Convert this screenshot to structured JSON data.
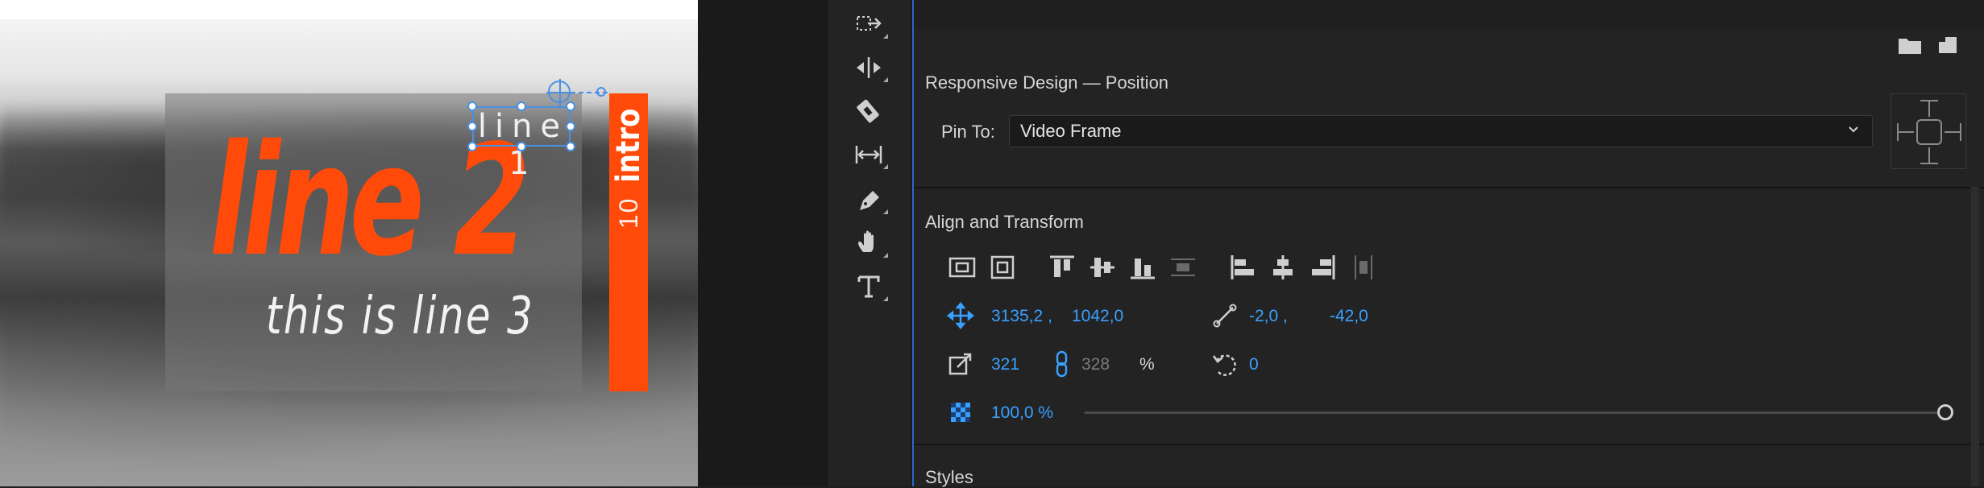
{
  "monitor": {
    "graphic_text": {
      "line1": "line 1",
      "line2": "line 2",
      "line3": "this is line 3",
      "intro_word": "intro",
      "intro_number": "10"
    },
    "colors": {
      "accent_orange": "#ff4a0a",
      "selection_blue": "#4a90e2"
    }
  },
  "tools": [
    {
      "icon": "track-select-forward-icon"
    },
    {
      "icon": "ripple-edit-icon"
    },
    {
      "icon": "razor-icon"
    },
    {
      "icon": "slip-icon"
    },
    {
      "icon": "pen-icon"
    },
    {
      "icon": "hand-icon"
    },
    {
      "icon": "type-icon"
    }
  ],
  "panel": {
    "header_icons": [
      "new-folder-icon",
      "new-item-icon"
    ],
    "responsive": {
      "title": "Responsive Design — Position",
      "pin_label": "Pin To:",
      "pin_value": "Video Frame"
    },
    "align": {
      "title": "Align and Transform",
      "align_icons": [
        "align-to-selection-icon",
        "align-to-frame-icon",
        "align-top-icon",
        "align-vertical-center-icon",
        "align-bottom-icon",
        "distribute-vertical-icon",
        "align-left-icon",
        "align-horizontal-center-icon",
        "align-right-icon",
        "distribute-horizontal-icon"
      ],
      "position_x": "3135,2 ,",
      "position_y": "1042,0",
      "anchor_x": "-2,0 ,",
      "anchor_y": "-42,0",
      "scale_w": "321",
      "scale_h": "328",
      "scale_unit": "%",
      "rotation": "0",
      "opacity": "100,0 %",
      "opacity_value": 100
    },
    "styles_title": "Styles",
    "accent_blue": "#3aa0ff"
  }
}
